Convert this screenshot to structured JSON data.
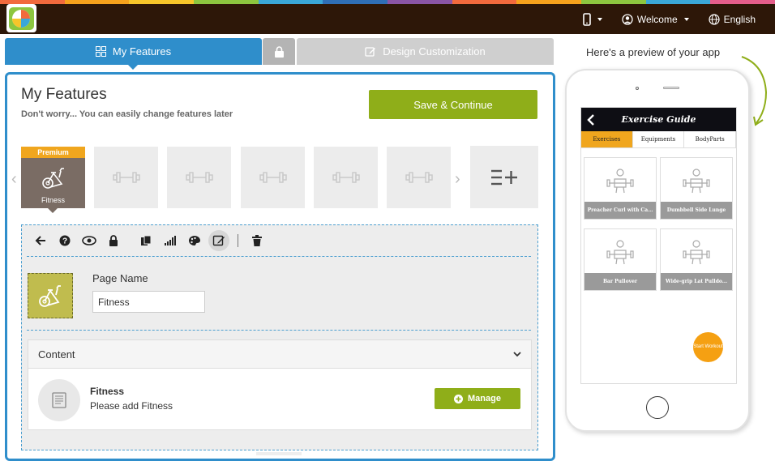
{
  "colors": {
    "rainbow": [
      "#f26a3d",
      "#f6a21c",
      "#f7c52a",
      "#8dc63f",
      "#3aa7d8",
      "#2f6fb6",
      "#8a55a5",
      "#f26a3d",
      "#f6a21c",
      "#8dc63f",
      "#3aa7d8",
      "#e55e8b"
    ],
    "accent_blue": "#2f8ecb",
    "accent_green": "#8fae19",
    "premium_orange": "#f0a61e",
    "topbar": "#2d1708"
  },
  "header": {
    "logo_icon": "appypie-logo-icon",
    "device_icon": "mobile-phone-icon",
    "welcome_label": "Welcome",
    "language_label": "English"
  },
  "tabs": {
    "my_features": "My Features",
    "design": "Design Customization"
  },
  "panel": {
    "title": "My Features",
    "subtitle": "Don't worry... You can easily change features later",
    "save_label": "Save & Continue",
    "premium_label": "Premium",
    "active_feature_label": "Fitness"
  },
  "toolbar_icons": [
    "back-arrow-icon",
    "help-icon",
    "preview-eye-icon",
    "lock-icon",
    "copy-icon",
    "signal-icon",
    "palette-icon",
    "edit-icon",
    "delete-icon"
  ],
  "page_settings": {
    "page_name_label": "Page Name",
    "page_name_value": "Fitness"
  },
  "content": {
    "header": "Content",
    "item_title": "Fitness",
    "item_sub": "Please add Fitness",
    "manage_label": "Manage"
  },
  "preview": {
    "label": "Here's a preview of your app",
    "app_title": "Exercise Guide",
    "tabs": [
      "Exercises",
      "Equipments",
      "BodyParts"
    ],
    "cards": [
      "Preacher Curl with Ca...",
      "Dumbbell Side Lunge",
      "Bar Pullover",
      "Wide-grip Lat Pulldo..."
    ],
    "start_button": "Start Workout"
  }
}
